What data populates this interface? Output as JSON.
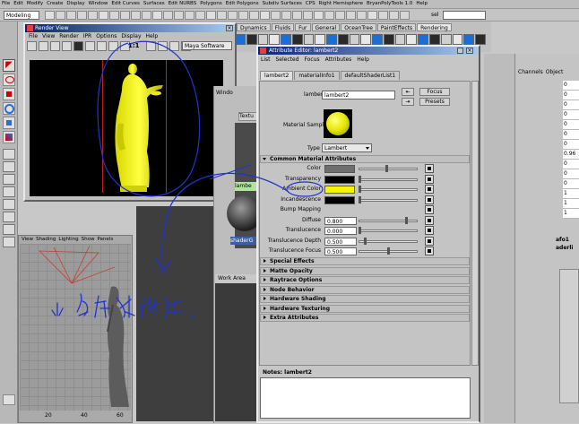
{
  "main_menu": [
    "File",
    "Edit",
    "Modify",
    "Create",
    "Display",
    "Window",
    "Edit Curves",
    "Surfaces",
    "Edit NURBS",
    "Polygons",
    "Edit Polygons",
    "Subdiv Surfaces",
    "CPS",
    "Right Hemisphere",
    "BryanPolyTools 1.0",
    "Help"
  ],
  "mode_selector": "Modeling",
  "shelf_tabs": [
    "Dynamics",
    "Fluids",
    "Fur",
    "General",
    "OceanTree",
    "PaintEffects",
    "Rendering"
  ],
  "sel_label": "sel",
  "render_view": {
    "title": "Render View",
    "menu": [
      "File",
      "View",
      "Render",
      "IPR",
      "Options",
      "Display",
      "Help"
    ],
    "ratio": "1:1",
    "renderer": "Maya Software"
  },
  "viewport_menu": [
    "View",
    "Shading",
    "Lighting",
    "Show",
    "Panels"
  ],
  "viewport_ruler": [
    "20",
    "40",
    "60"
  ],
  "attribute_editor": {
    "title": "Attribute Editor: lambert2",
    "menu": [
      "List",
      "Selected",
      "Focus",
      "Attributes",
      "Help"
    ],
    "tabs": [
      "lambert2",
      "materialInfo1",
      "defaultShaderList1"
    ],
    "node_label": "lambert:",
    "node_name": "lambert2",
    "focus_label": "Focus",
    "presets_label": "Presets",
    "sample_label": "Material Sample",
    "type_label": "Type",
    "type_value": "Lambert",
    "common_section": "Common Material Attributes",
    "attrs": [
      {
        "label": "Color",
        "kind": "color",
        "swatch": "#6e6e6e"
      },
      {
        "label": "Transparency",
        "kind": "color",
        "swatch": "#000000"
      },
      {
        "label": "Ambient Color",
        "kind": "color",
        "swatch": "#f6f600"
      },
      {
        "label": "Incandescence",
        "kind": "color",
        "swatch": "#000000"
      },
      {
        "label": "Bump Mapping",
        "kind": "none"
      },
      {
        "label": "Diffuse",
        "kind": "value",
        "value": "0.800"
      },
      {
        "label": "Translucence",
        "kind": "value",
        "value": "0.000"
      },
      {
        "label": "Translucence Depth",
        "kind": "value",
        "value": "0.500"
      },
      {
        "label": "Translucence Focus",
        "kind": "value",
        "value": "0.500"
      }
    ],
    "sections": [
      "Special Effects",
      "Matte Opacity",
      "Raytrace Options",
      "Node Behavior",
      "Hardware Shading",
      "Hardware Texturing",
      "Extra Attributes"
    ],
    "notes_label": "Notes: lambert2"
  },
  "hypershade": {
    "window_label": "Windo",
    "textures_label": "Textu",
    "lambert_label": "lambe",
    "shader_label": "shaderG",
    "work_area": "Work Area"
  },
  "channel_box": {
    "tabs": [
      "Channels",
      "Object"
    ],
    "rows": [
      "0",
      "0",
      "0",
      "0",
      "0",
      "0",
      "0",
      "0.96",
      "0",
      "0",
      "0",
      "1",
      "1",
      "1"
    ],
    "side_labels": [
      "afo1",
      "aderli"
    ]
  },
  "colors": {
    "accent_blue": "#0a246a",
    "title_blue": "#3a5ea8",
    "yellow": "#f6f600",
    "annotation_blue": "#2233cc"
  }
}
